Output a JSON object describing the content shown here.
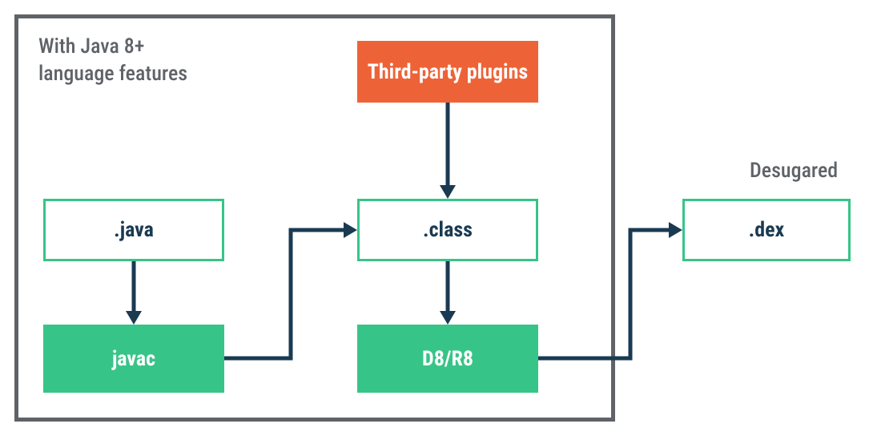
{
  "diagram": {
    "header_line1": "With Java 8+",
    "header_line2": "language features",
    "boxes": {
      "java": ".java",
      "javac": "javac",
      "class": ".class",
      "d8r8": "D8/R8",
      "plugins": "Third-party plugins",
      "dex": ".dex"
    },
    "labels": {
      "desugared": "Desugared"
    },
    "colors": {
      "border_gray": "#5f6368",
      "green": "#37c488",
      "orange": "#ed6337",
      "arrow_navy": "#1a3a52"
    },
    "flow": [
      {
        "from": "java",
        "to": "javac"
      },
      {
        "from": "javac",
        "to": "class"
      },
      {
        "from": "plugins",
        "to": "class"
      },
      {
        "from": "class",
        "to": "d8r8"
      },
      {
        "from": "d8r8",
        "to": "dex"
      }
    ]
  }
}
